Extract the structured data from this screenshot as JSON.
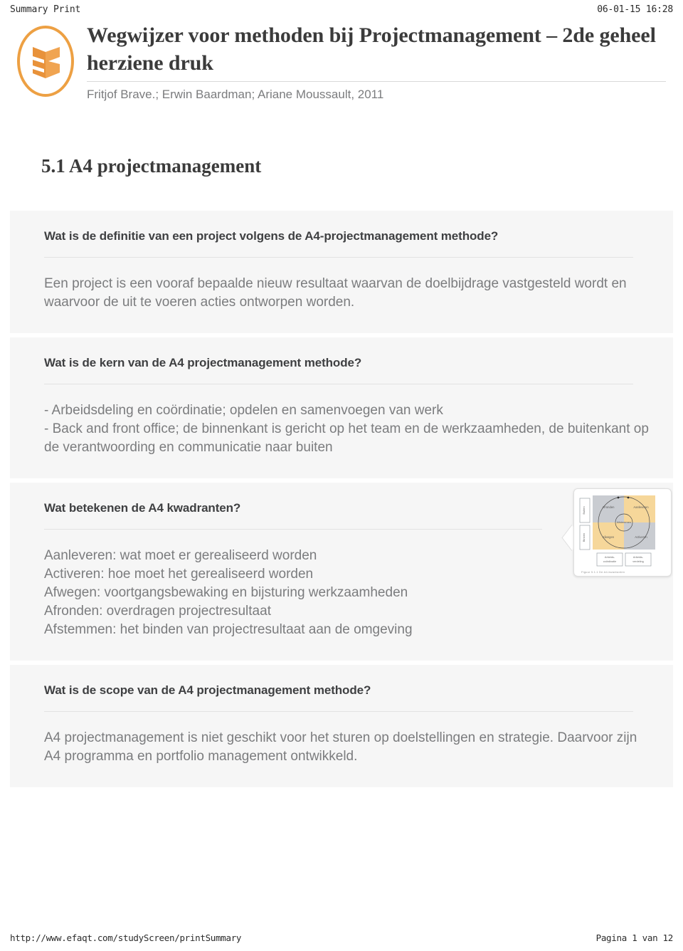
{
  "header": {
    "left_label": "Summary Print",
    "timestamp": "06-01-15 16:28"
  },
  "document": {
    "title": "Wegwijzer voor methoden bij Projectmanagement – 2de geheel herziene druk",
    "authors": "Fritjof Brave.; Erwin Baardman; Ariane Moussault, 2011",
    "logo_icon": "open-book-logo-icon",
    "logo_color": "#eda043"
  },
  "chapter": {
    "heading": "5.1 A4 projectmanagement"
  },
  "qa_blocks": [
    {
      "question": "Wat is de definitie van een project volgens de A4-projectmanagement methode?",
      "answer": "Een project is een vooraf bepaalde nieuw resultaat waarvan de doelbijdrage vastgesteld wordt en waarvoor de uit te voeren acties ontworpen worden."
    },
    {
      "question": "Wat is de kern van de A4 projectmanagement methode?",
      "answer": "- Arbeidsdeling en coördinatie; opdelen en samenvoegen van werk\n- Back and front office; de binnenkant is gericht op het team en de werkzaamheden, de buitenkant op de verantwoording en communicatie naar buiten"
    },
    {
      "question": "Wat betekenen de A4 kwadranten?",
      "answer": "Aanleveren: wat moet er gerealiseerd worden\nActiveren: hoe moet het gerealiseerd worden\nAfwegen: voortgangsbewaking en bijsturing werkzaamheden\nAfronden: overdragen projectresultaat\nAfstemmen: het binden van projectresultaat aan de omgeving",
      "thumbnail": {
        "name": "a4-kwadranten-diagram-thumbnail",
        "caption": "Figuur 5.1.1   De A4-kwadranten",
        "quadrants": [
          {
            "label": "Afronden",
            "color": "#c9ccd1"
          },
          {
            "label": "Aanleveren",
            "color": "#f6d79a"
          },
          {
            "label": "Afwegen",
            "color": "#f6d79a"
          },
          {
            "label": "Activeren",
            "color": "#c9ccd1"
          }
        ],
        "center_label": "Afstemmen",
        "side_labels": [
          "Buiten",
          "Binnen"
        ],
        "bottom_labels": [
          "Arbeids- coördinatie",
          "Arbeids- verdeling"
        ]
      }
    },
    {
      "question": "Wat is de scope van de A4 projectmanagement methode?",
      "answer": "A4 projectmanagement is niet geschikt voor het sturen op doelstellingen en strategie. Daarvoor zijn A4 programma en portfolio management ontwikkeld."
    }
  ],
  "footer": {
    "url": "http://www.efaqt.com/studyScreen/printSummary",
    "page_label": "Pagina 1 van 12"
  }
}
